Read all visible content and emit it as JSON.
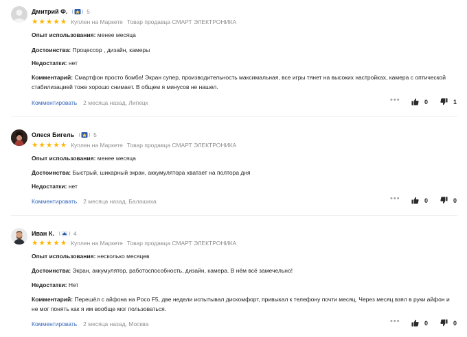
{
  "reviews": [
    {
      "author": "Дмитрий Ф.",
      "badge_score": "5",
      "meta": {
        "purchased": "Куплен на Маркете",
        "seller": "Товар продавца СМАРТ ЭЛЕКТРОНИКА"
      },
      "rating": 5,
      "fields": [
        {
          "label": "Опыт использования:",
          "value": "менее месяца"
        },
        {
          "label": "Достоинства:",
          "value": "Процессор , дизайн, камеры"
        },
        {
          "label": "Недостатки:",
          "value": "нет"
        },
        {
          "label": "Комментарий:",
          "value": "Смартфон просто бомба! Экран супер, производительность максимальная, все игры тянет на высоких настройках, камера с оптической стабилизацией тоже хорошо снимает. В общем я минусов не нашел."
        }
      ],
      "comment_link": "Комментировать",
      "date": "2 месяца назад, Липецк",
      "likes": "0",
      "dislikes": "1"
    },
    {
      "author": "Олеся Бигель",
      "badge_score": "5",
      "meta": {
        "purchased": "Куплен на Маркете",
        "seller": "Товар продавца СМАРТ ЭЛЕКТРОНИКА"
      },
      "rating": 5,
      "fields": [
        {
          "label": "Опыт использования:",
          "value": "менее месяца"
        },
        {
          "label": "Достоинства:",
          "value": "Быстрый, шикарный экран, аккумулятора хватает на полтора дня"
        },
        {
          "label": "Недостатки:",
          "value": "нет"
        }
      ],
      "comment_link": "Комментировать",
      "date": "2 месяца назад, Балашиха",
      "likes": "0",
      "dislikes": "0"
    },
    {
      "author": "Иван К.",
      "badge_score": "4",
      "meta": {
        "purchased": "Куплен на Маркете",
        "seller": "Товар продавца СМАРТ ЭЛЕКТРОНИКА"
      },
      "rating": 5,
      "fields": [
        {
          "label": "Опыт использования:",
          "value": "несколько месяцев"
        },
        {
          "label": "Достоинства:",
          "value": "Экран, аккумулятор, работоспособность, дизайн, камера. В нём всё замечельно!"
        },
        {
          "label": "Недостатки:",
          "value": "Нет"
        },
        {
          "label": "Комментарий:",
          "value": "Перешёл с айфона на Poco F5, две недели испытывал дискомфорт, привыкал к телефону почти месяц. Через месяц взял в руки айфон и не мог понять как я им вообще мог пользоваться."
        }
      ],
      "comment_link": "Комментировать",
      "date": "2 месяца назад, Москва",
      "likes": "0",
      "dislikes": "0"
    }
  ],
  "colors": {
    "star": "#ffb300",
    "link": "#3366bb",
    "muted": "#8f8f8f",
    "badge": "#2d5bb0"
  }
}
